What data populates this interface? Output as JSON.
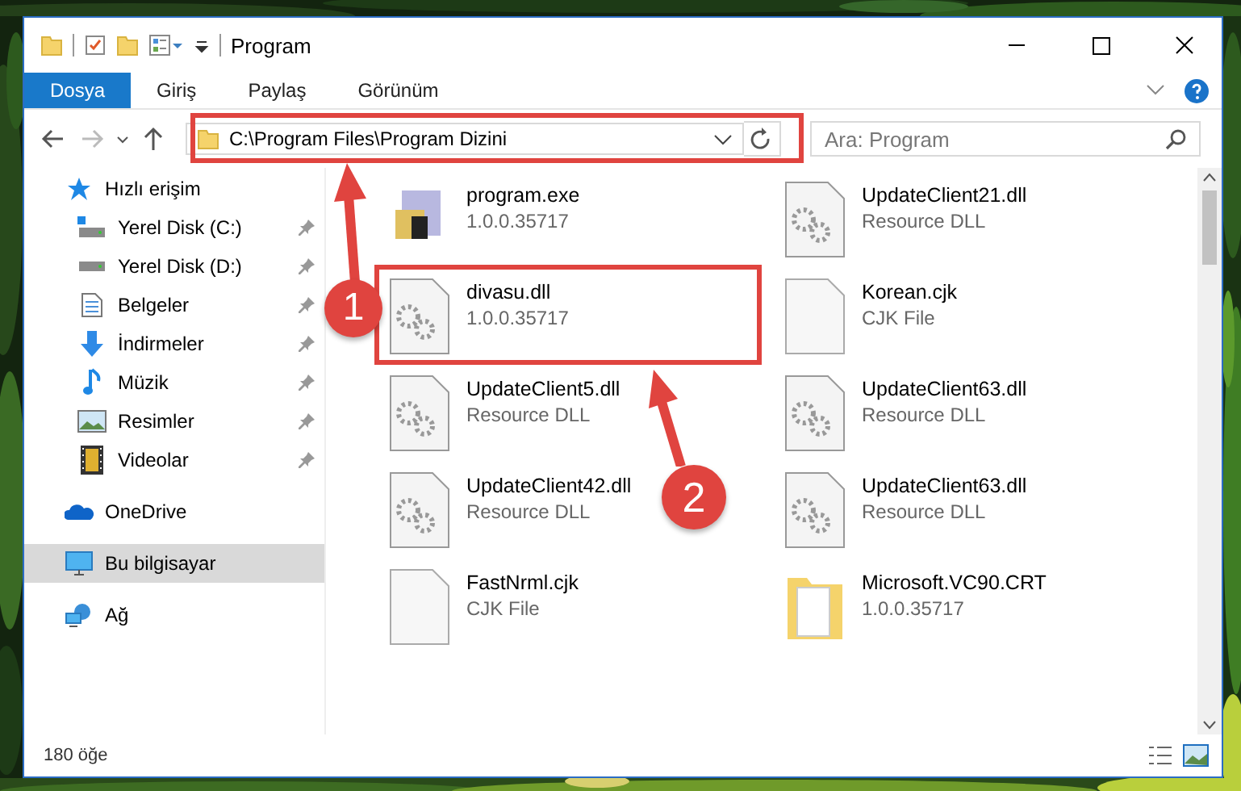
{
  "window": {
    "title": "Program"
  },
  "ribbon_tabs": [
    {
      "label": "Dosya",
      "selected": true
    },
    {
      "label": "Giriş",
      "selected": false
    },
    {
      "label": "Paylaş",
      "selected": false
    },
    {
      "label": "Görünüm",
      "selected": false
    }
  ],
  "address": {
    "path": "C:\\Program Files\\Program Dizini"
  },
  "search": {
    "placeholder": "Ara: Program"
  },
  "nav": [
    {
      "label": "Hızlı erişim",
      "kind": "star",
      "selected": false,
      "children": [
        {
          "label": "Yerel Disk (C:)",
          "kind": "system-drive",
          "pinned": true,
          "selected": false
        },
        {
          "label": "Yerel Disk (D:)",
          "kind": "drive",
          "pinned": true,
          "selected": false
        },
        {
          "label": "Belgeler",
          "kind": "document",
          "pinned": true,
          "selected": false
        },
        {
          "label": "İndirmeler",
          "kind": "download",
          "pinned": true,
          "selected": false
        },
        {
          "label": "Müzik",
          "kind": "music",
          "pinned": true,
          "selected": false
        },
        {
          "label": "Resimler",
          "kind": "pictures",
          "pinned": true,
          "selected": false
        },
        {
          "label": "Videolar",
          "kind": "video",
          "pinned": true,
          "selected": false
        }
      ]
    },
    {
      "label": "OneDrive",
      "kind": "cloud",
      "selected": false
    },
    {
      "label": "Bu bilgisayar",
      "kind": "computer",
      "selected": true
    },
    {
      "label": "Ağ",
      "kind": "network",
      "selected": false
    }
  ],
  "files": [
    {
      "name": "program.exe",
      "detail": "1.0.0.35717",
      "kind": "exe"
    },
    {
      "name": "UpdateClient21.dll",
      "detail": "Resource DLL",
      "kind": "dll"
    },
    {
      "name": "divasu.dll",
      "detail": "1.0.0.35717",
      "kind": "dll"
    },
    {
      "name": "Korean.cjk",
      "detail": "CJK File",
      "kind": "file"
    },
    {
      "name": "UpdateClient5.dll",
      "detail": "Resource DLL",
      "kind": "dll"
    },
    {
      "name": "UpdateClient63.dll",
      "detail": "Resource DLL",
      "kind": "dll"
    },
    {
      "name": "UpdateClient42.dll",
      "detail": "Resource DLL",
      "kind": "dll"
    },
    {
      "name": "UpdateClient63.dll",
      "detail": "Resource DLL",
      "kind": "dll"
    },
    {
      "name": "FastNrml.cjk",
      "detail": "CJK File",
      "kind": "file"
    },
    {
      "name": "Microsoft.VC90.CRT",
      "detail": "1.0.0.35717",
      "kind": "folder"
    }
  ],
  "status_bar": {
    "count": "180 öğe"
  },
  "annotations": [
    {
      "label": "1"
    },
    {
      "label": "2"
    }
  ]
}
